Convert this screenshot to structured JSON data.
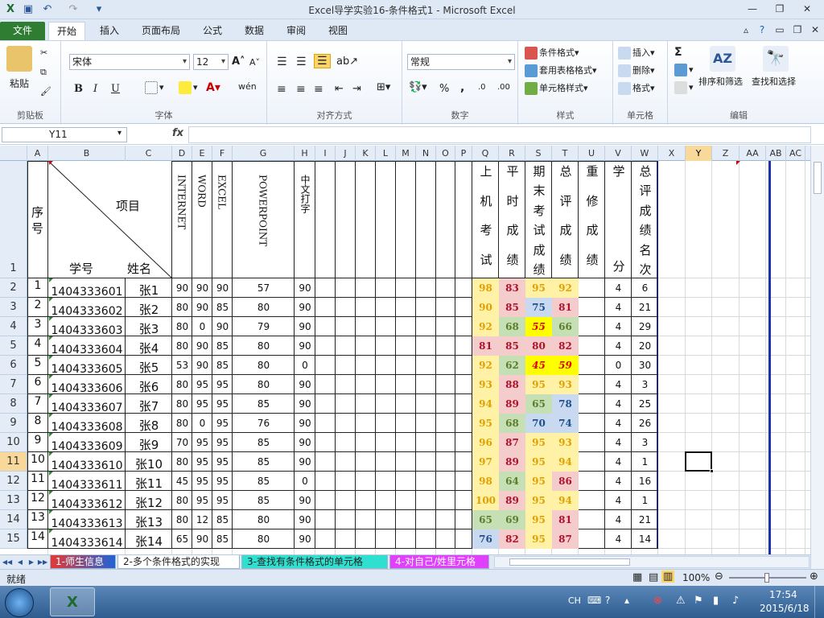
{
  "title": "Excel导学实验16-条件格式1 - Microsoft Excel",
  "tabs": [
    "文件",
    "开始",
    "插入",
    "页面布局",
    "公式",
    "数据",
    "审阅",
    "视图"
  ],
  "ribbon": {
    "clipboard": {
      "paste": "粘贴",
      "label": "剪贴板"
    },
    "font": {
      "name": "宋体",
      "size": "12",
      "label": "字体",
      "bold": "B",
      "italic": "I",
      "underline": "U",
      "wen": "wén"
    },
    "align": {
      "label": "对齐方式"
    },
    "number": {
      "format": "常规",
      "label": "数字",
      "percent": "%",
      "comma": ","
    },
    "styles": {
      "cond": "条件格式",
      "table": "套用表格格式",
      "cell": "单元格样式",
      "label": "样式"
    },
    "cells": {
      "insert": "插入",
      "delete": "删除",
      "format": "格式",
      "label": "单元格"
    },
    "edit": {
      "sum": "Σ",
      "sort": "排序和筛选",
      "find": "查找和选择",
      "label": "编辑"
    }
  },
  "formula": {
    "namebox": "Y11",
    "fx": "fx"
  },
  "columns": [
    "A",
    "B",
    "C",
    "D",
    "E",
    "F",
    "G",
    "H",
    "I",
    "J",
    "K",
    "L",
    "M",
    "N",
    "O",
    "P",
    "Q",
    "R",
    "S",
    "T",
    "U",
    "V",
    "W",
    "X",
    "Y",
    "Z",
    "AA",
    "AB",
    "AC"
  ],
  "rows": [
    "1",
    "2",
    "3",
    "4",
    "5",
    "6",
    "7",
    "8",
    "9",
    "10",
    "11",
    "12",
    "13",
    "14",
    "15"
  ],
  "header": {
    "seq": [
      "序",
      "号"
    ],
    "item": "项目",
    "sid": "学号",
    "sname": "姓名",
    "internet": "INTERNET",
    "word": "WORD",
    "excel": "EXCEL",
    "ppt": "POWERPOINT",
    "ch": "中文打字",
    "q": [
      "上",
      "机",
      "考",
      "试"
    ],
    "r": [
      "平",
      "时",
      "成",
      "绩"
    ],
    "s": [
      "期",
      "末",
      "考",
      "试",
      "成",
      "绩"
    ],
    "t": [
      "总",
      "评",
      "成",
      "绩"
    ],
    "u": [
      "重",
      "修",
      "成",
      "绩"
    ],
    "v": [
      "学",
      "分"
    ],
    "w": [
      "总",
      "评",
      "成",
      "绩",
      "名",
      "次"
    ]
  },
  "students": [
    {
      "seq": "1",
      "id": "1404333601",
      "name": "张1",
      "d": "90",
      "e": "90",
      "f": "90",
      "g": "57",
      "h": "90",
      "q": "98",
      "r": "83",
      "s": "95",
      "t": "92",
      "v": "4",
      "w": "6"
    },
    {
      "seq": "2",
      "id": "1404333602",
      "name": "张2",
      "d": "80",
      "e": "90",
      "f": "85",
      "g": "80",
      "h": "90",
      "q": "90",
      "r": "85",
      "s": "75",
      "t": "81",
      "v": "4",
      "w": "21"
    },
    {
      "seq": "3",
      "id": "1404333603",
      "name": "张3",
      "d": "80",
      "e": "0",
      "f": "90",
      "g": "79",
      "h": "90",
      "q": "92",
      "r": "68",
      "s": "55",
      "t": "66",
      "v": "4",
      "w": "29"
    },
    {
      "seq": "4",
      "id": "1404333604",
      "name": "张4",
      "d": "80",
      "e": "90",
      "f": "85",
      "g": "80",
      "h": "90",
      "q": "81",
      "r": "85",
      "s": "80",
      "t": "82",
      "v": "4",
      "w": "20"
    },
    {
      "seq": "5",
      "id": "1404333605",
      "name": "张5",
      "d": "53",
      "e": "90",
      "f": "85",
      "g": "80",
      "h": "0",
      "q": "92",
      "r": "62",
      "s": "45",
      "t": "59",
      "v": "0",
      "w": "30"
    },
    {
      "seq": "6",
      "id": "1404333606",
      "name": "张6",
      "d": "80",
      "e": "95",
      "f": "95",
      "g": "80",
      "h": "90",
      "q": "93",
      "r": "88",
      "s": "95",
      "t": "93",
      "v": "4",
      "w": "3"
    },
    {
      "seq": "7",
      "id": "1404333607",
      "name": "张7",
      "d": "80",
      "e": "95",
      "f": "95",
      "g": "85",
      "h": "90",
      "q": "94",
      "r": "89",
      "s": "65",
      "t": "78",
      "v": "4",
      "w": "25"
    },
    {
      "seq": "8",
      "id": "1404333608",
      "name": "张8",
      "d": "80",
      "e": "0",
      "f": "95",
      "g": "76",
      "h": "90",
      "q": "95",
      "r": "68",
      "s": "70",
      "t": "74",
      "v": "4",
      "w": "26"
    },
    {
      "seq": "9",
      "id": "1404333609",
      "name": "张9",
      "d": "70",
      "e": "95",
      "f": "95",
      "g": "85",
      "h": "90",
      "q": "96",
      "r": "87",
      "s": "95",
      "t": "93",
      "v": "4",
      "w": "3"
    },
    {
      "seq": "10",
      "id": "1404333610",
      "name": "张10",
      "d": "80",
      "e": "95",
      "f": "95",
      "g": "85",
      "h": "90",
      "q": "97",
      "r": "89",
      "s": "95",
      "t": "94",
      "v": "4",
      "w": "1"
    },
    {
      "seq": "11",
      "id": "1404333611",
      "name": "张11",
      "d": "45",
      "e": "95",
      "f": "95",
      "g": "85",
      "h": "0",
      "q": "98",
      "r": "64",
      "s": "95",
      "t": "86",
      "v": "4",
      "w": "16"
    },
    {
      "seq": "12",
      "id": "1404333612",
      "name": "张12",
      "d": "80",
      "e": "95",
      "f": "95",
      "g": "85",
      "h": "90",
      "q": "100",
      "r": "89",
      "s": "95",
      "t": "94",
      "v": "4",
      "w": "1"
    },
    {
      "seq": "13",
      "id": "1404333613",
      "name": "张13",
      "d": "80",
      "e": "12",
      "f": "85",
      "g": "80",
      "h": "90",
      "q": "65",
      "r": "69",
      "s": "95",
      "t": "81",
      "v": "4",
      "w": "21"
    },
    {
      "seq": "14",
      "id": "1404333614",
      "name": "张14",
      "d": "65",
      "e": "90",
      "f": "85",
      "g": "80",
      "h": "90",
      "q": "76",
      "r": "82",
      "s": "95",
      "t": "87",
      "v": "4",
      "w": "14"
    }
  ],
  "sheets": [
    "1-师生信息",
    "2-多个条件格式的实现",
    "3-查找有条件格式的单元格",
    "4-对自己/姓里元格"
  ],
  "status": {
    "ready": "就绪",
    "zoom": "100%"
  },
  "taskbar": {
    "lang": "CH",
    "time": "17:54",
    "date": "2015/6/18"
  },
  "colors": {
    "yellow": "#fff2a6",
    "red": "#f4cccc",
    "green": "#c6dfb4",
    "blue": "#c9daf0",
    "accent": "#2e7d32"
  }
}
